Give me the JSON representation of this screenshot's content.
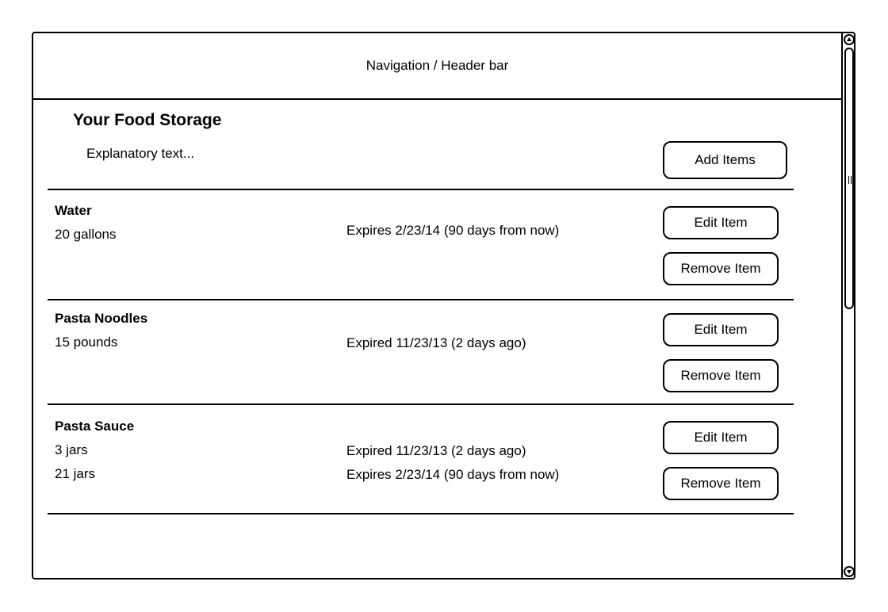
{
  "header": {
    "title": "Navigation / Header bar"
  },
  "page": {
    "title": "Your Food Storage",
    "explanatory": "Explanatory text...",
    "add_button": "Add Items"
  },
  "items": [
    {
      "name": "Water",
      "lines": [
        {
          "quantity": "20 gallons",
          "expiry": "Expires 2/23/14 (90 days from now)"
        }
      ],
      "edit_label": "Edit Item",
      "remove_label": "Remove Item"
    },
    {
      "name": "Pasta Noodles",
      "lines": [
        {
          "quantity": "15 pounds",
          "expiry": "Expired 11/23/13 (2 days ago)"
        }
      ],
      "edit_label": "Edit Item",
      "remove_label": "Remove Item"
    },
    {
      "name": "Pasta Sauce",
      "lines": [
        {
          "quantity": "3 jars",
          "expiry": "Expired 11/23/13 (2 days ago)"
        },
        {
          "quantity": "21 jars",
          "expiry": "Expires 2/23/14 (90 days from now)"
        }
      ],
      "edit_label": "Edit Item",
      "remove_label": "Remove Item"
    }
  ],
  "icons": {
    "scroll_up": "chevron-up-icon",
    "scroll_down": "chevron-down-icon"
  }
}
